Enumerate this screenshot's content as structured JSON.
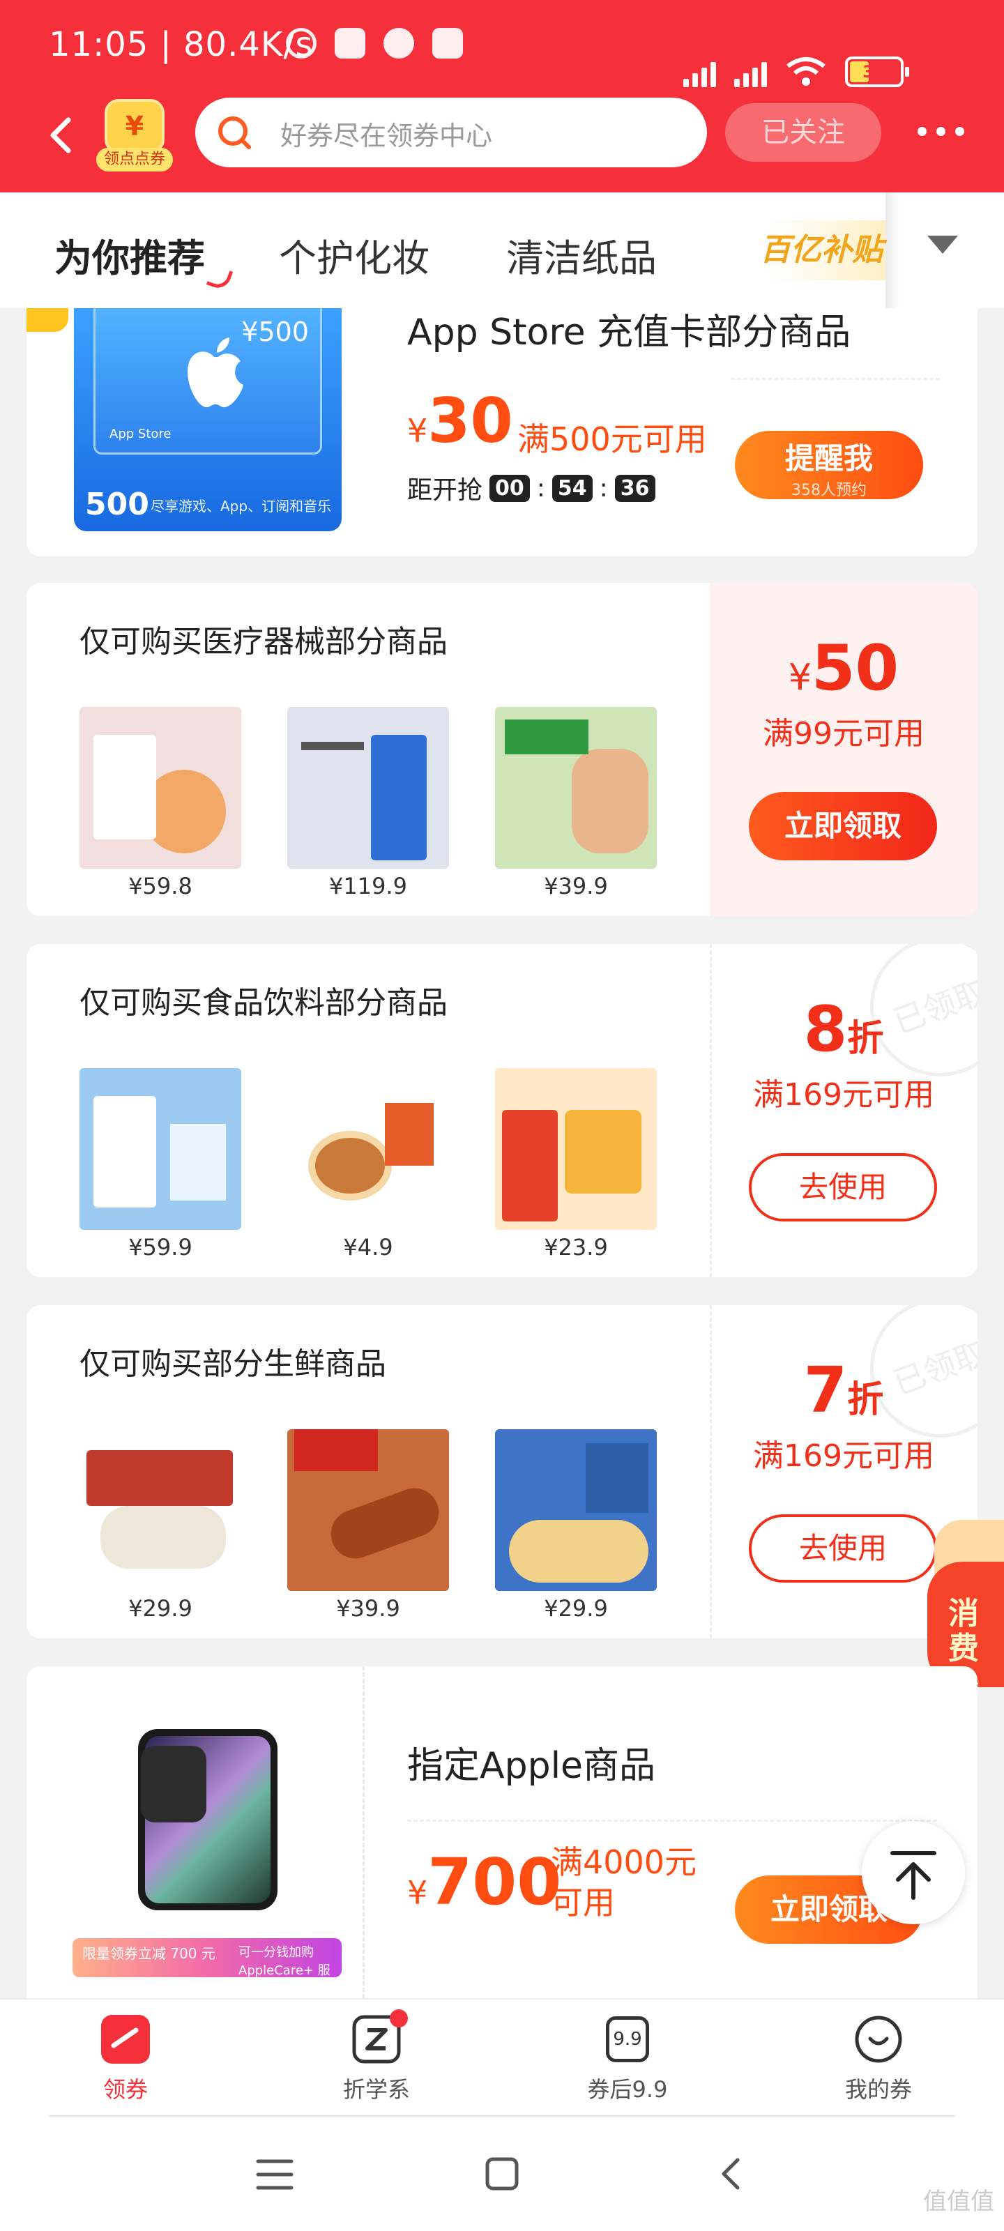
{
  "status": {
    "time": "11:05 | 80.4K/s",
    "battery": "31"
  },
  "header": {
    "points_coin": "¥",
    "points_label": "领点点券",
    "search_placeholder": "好券尽在领券中心",
    "follow_label": "已关注"
  },
  "tabs": [
    "为你推荐",
    "个护化妆",
    "清洁纸品",
    "百亿补贴"
  ],
  "card1": {
    "gift_amount": "¥500",
    "gift_brand": "App Store",
    "gift_big": "500",
    "gift_sub": "尽享游戏、App、订阅和音乐",
    "title": "App Store 充值卡部分商品",
    "price_symbol": "¥",
    "price": "30",
    "condition": "满500元可用",
    "countdown_label": "距开抢",
    "countdown": [
      "00",
      "54",
      "36"
    ],
    "button": "提醒我",
    "button_sub": "358人预约"
  },
  "card2": {
    "title": "仅可购买医疗器械部分商品",
    "products": [
      {
        "price": "¥59.8",
        "color": "#f3dede"
      },
      {
        "price": "¥119.9",
        "color": "#dfe3ee"
      },
      {
        "price": "¥39.9",
        "color": "#cfe4b7"
      }
    ],
    "amount_symbol": "¥",
    "amount": "50",
    "condition": "满99元可用",
    "button": "立即领取"
  },
  "card3": {
    "title": "仅可购买食品饮料部分商品",
    "products": [
      {
        "price": "¥59.9",
        "color": "#9ccaf0"
      },
      {
        "price": "¥4.9",
        "color": "#ffffff"
      },
      {
        "price": "¥23.9",
        "color": "#ffe8c8"
      }
    ],
    "amount": "8",
    "amount_unit": "折",
    "condition": "满169元可用",
    "button": "去使用",
    "stamp": "已领取"
  },
  "card4": {
    "title": "仅可购买部分生鲜商品",
    "products": [
      {
        "price": "¥29.9",
        "color": "#e9e4de"
      },
      {
        "price": "¥39.9",
        "color": "#c86a3a"
      },
      {
        "price": "¥29.9",
        "color": "#3f73c7"
      }
    ],
    "amount": "7",
    "amount_unit": "折",
    "condition": "满169元可用",
    "button": "去使用",
    "stamp": "已领取"
  },
  "card5": {
    "banner_left": "限量领券立减 700 元",
    "banner_right": "可一分钱加购 AppleCare+ 服务",
    "title": "指定Apple商品",
    "price_symbol": "¥",
    "price": "700",
    "condition_line1": "满4000元",
    "condition_line2": "可用",
    "button": "立即领取"
  },
  "float_label": "消费补贴",
  "bottom_nav": [
    {
      "label": "领券"
    },
    {
      "label": "折学系"
    },
    {
      "label": "券后9.9",
      "icon_text": "9.9"
    },
    {
      "label": "我的券"
    }
  ],
  "watermark": "值值值"
}
